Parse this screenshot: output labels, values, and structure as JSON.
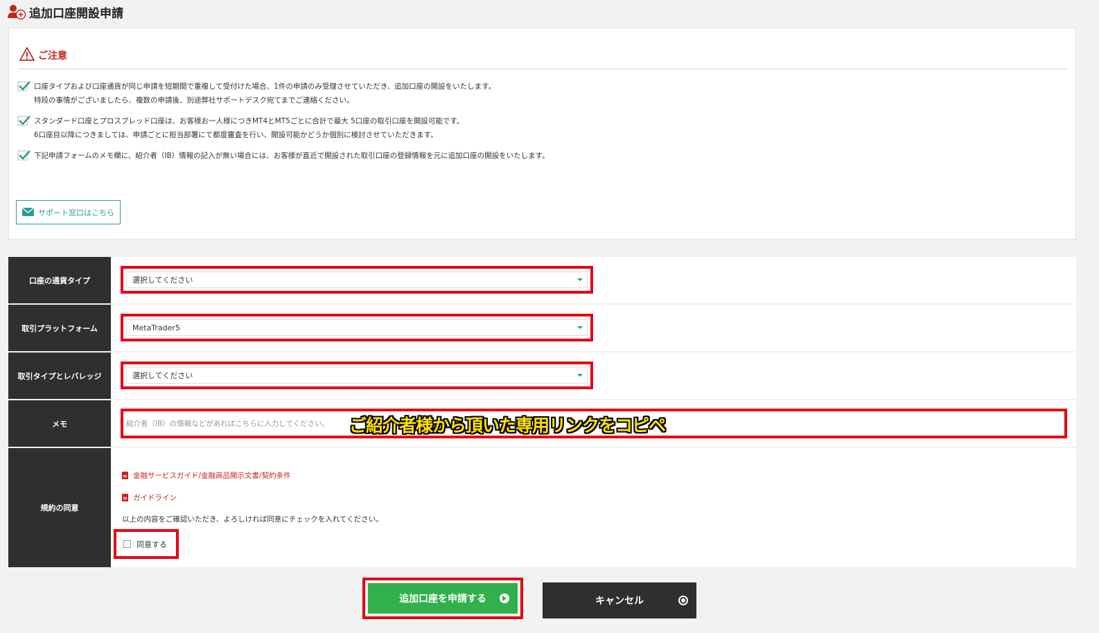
{
  "header": {
    "title": "追加口座開設申請",
    "icon": "user-add-icon"
  },
  "notice": {
    "title": "ご注意",
    "items": [
      {
        "lines": [
          "口座タイプおよび口座通貨が同じ申請を短期間で重複して受付けた場合、1件の申請のみ受理させていただき、追加口座の開設をいたします。",
          "特段の事情がございましたら、複数の申請後、別途弊社サポートデスク宛てまでご連絡ください。"
        ]
      },
      {
        "lines": [
          "スタンダード口座とプロスプレッド口座は、お客様お一人様につきMT4とMT5ごとに合計で最大 5口座の取引口座を開設可能です。",
          "6口座目以降につきましては、申請ごとに担当部署にて都度審査を行い、開設可能かどうか個別に検討させていただきます。"
        ]
      },
      {
        "lines": [
          "下記申請フォームのメモ欄に、紹介者（IB）情報の記入が無い場合には、お客様が直近で開設された取引口座の登録情報を元に追加口座の開設をいたします。"
        ]
      }
    ],
    "support_label": "サポート窓口はこちら"
  },
  "form": {
    "currency_type": {
      "label": "口座の通貨タイプ",
      "value": "選択してください"
    },
    "platform": {
      "label": "取引プラットフォーム",
      "value": "MetaTrader5"
    },
    "trade_type": {
      "label": "取引タイプとレバレッジ",
      "value": "選択してください"
    },
    "memo": {
      "label": "メモ",
      "placeholder": "紹介者（IB）の情報などがあればこちらに入力してください。",
      "annotation": "ご紹介者様から頂いた専用リンクをコピペ"
    },
    "agreement": {
      "label": "規約の同意",
      "links": [
        "金融サービスガイド/金融商品開示文書/契約条件",
        "ガイドライン"
      ],
      "note": "以上の内容をご確認いただき、よろしければ同意にチェックを入れてください。",
      "checkbox_label": "同意する",
      "checked": false
    }
  },
  "buttons": {
    "submit": "追加口座を申請する",
    "cancel": "キャンセル"
  },
  "colors": {
    "accent": "#2a9d8f",
    "warning": "#c5261d",
    "highlight": "#e60012",
    "submit": "#31b04b",
    "dark": "#2f2f2f"
  }
}
